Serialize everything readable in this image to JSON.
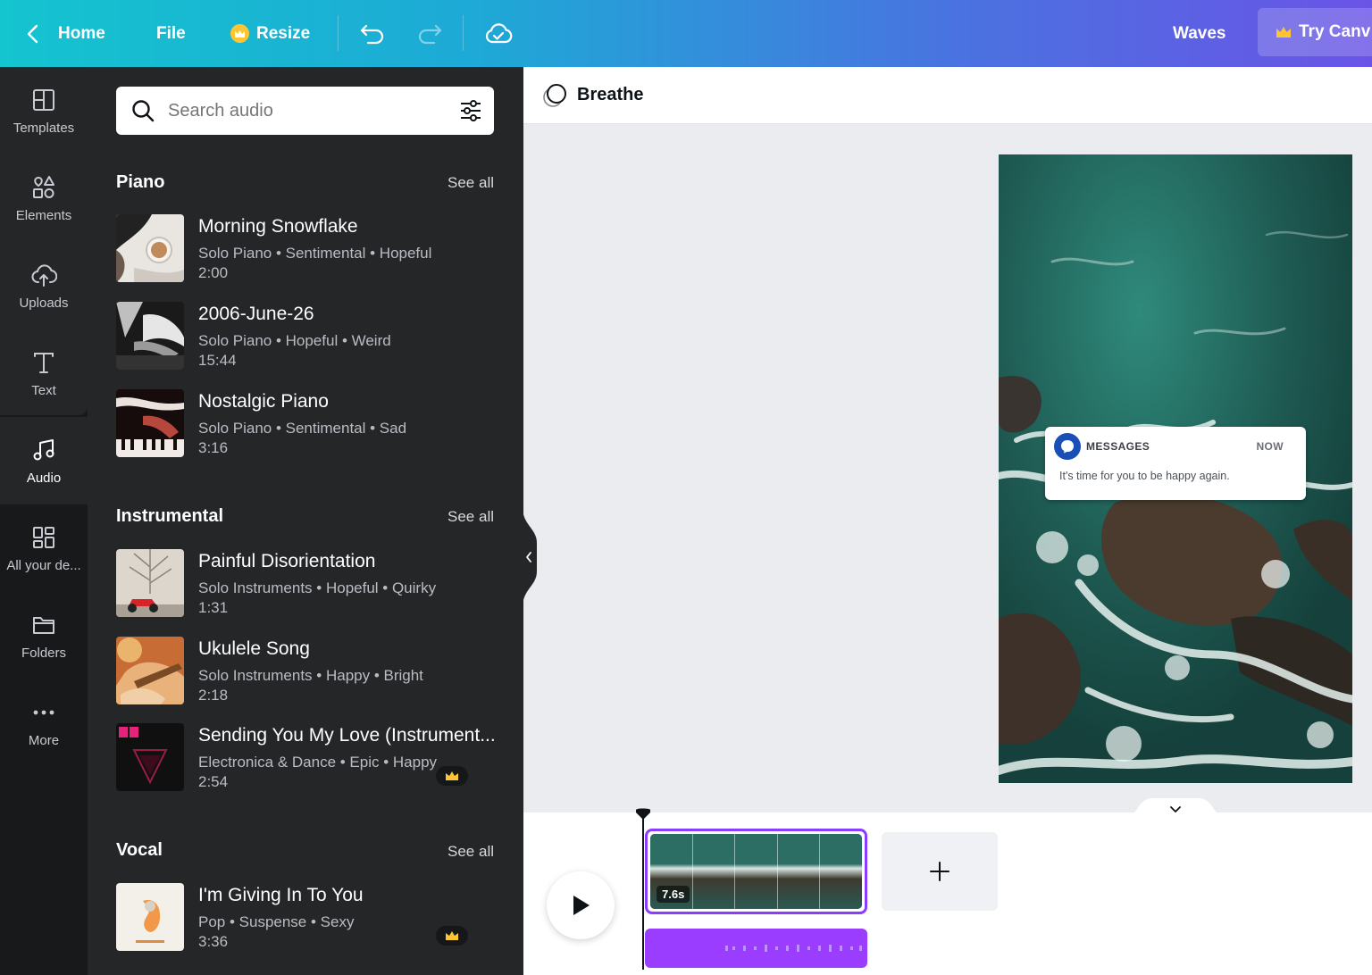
{
  "topbar": {
    "home_label": "Home",
    "file_label": "File",
    "resize_label": "Resize",
    "project_name": "Waves",
    "try_label": "Try Canv"
  },
  "rail": {
    "items": [
      {
        "label": "Templates",
        "icon": "templates-icon"
      },
      {
        "label": "Elements",
        "icon": "elements-icon"
      },
      {
        "label": "Uploads",
        "icon": "upload-cloud-icon"
      },
      {
        "label": "Text",
        "icon": "text-icon"
      },
      {
        "label": "Audio",
        "icon": "music-note-icon"
      },
      {
        "label": "All your de...",
        "icon": "grid-icon"
      },
      {
        "label": "Folders",
        "icon": "folder-icon"
      },
      {
        "label": "More",
        "icon": "more-dots-icon"
      }
    ]
  },
  "search": {
    "placeholder": "Search audio"
  },
  "sections": {
    "piano": {
      "title": "Piano",
      "see_all": "See all",
      "tracks": [
        {
          "title": "Morning Snowflake",
          "meta": "Solo Piano • Sentimental • Hopeful",
          "duration": "2:00"
        },
        {
          "title": "2006-June-26",
          "meta": "Solo Piano • Hopeful • Weird",
          "duration": "15:44"
        },
        {
          "title": "Nostalgic Piano",
          "meta": "Solo Piano • Sentimental • Sad",
          "duration": "3:16"
        }
      ]
    },
    "instrumental": {
      "title": "Instrumental",
      "see_all": "See all",
      "tracks": [
        {
          "title": "Painful Disorientation",
          "meta": "Solo Instruments • Hopeful • Quirky",
          "duration": "1:31"
        },
        {
          "title": "Ukulele Song",
          "meta": "Solo Instruments • Happy • Bright",
          "duration": "2:18"
        },
        {
          "title": "Sending You My Love (Instrument...",
          "meta": "Electronica & Dance • Epic • Happy",
          "duration": "2:54",
          "pro": true
        }
      ]
    },
    "vocal": {
      "title": "Vocal",
      "see_all": "See all",
      "tracks": [
        {
          "title": "I'm Giving In To You",
          "meta": "Pop • Suspense • Sexy",
          "duration": "3:36",
          "pro": true
        }
      ]
    }
  },
  "editor": {
    "doc_title": "Breathe",
    "notification": {
      "app": "MESSAGES",
      "time": "NOW",
      "text": "It's time for you to be happy again."
    }
  },
  "timeline": {
    "clip_duration": "7.6s"
  },
  "colors": {
    "accent_purple": "#8b3dff",
    "panel_bg": "#252627",
    "rail_bg": "#18191b",
    "pro_crown": "#ffc531"
  }
}
